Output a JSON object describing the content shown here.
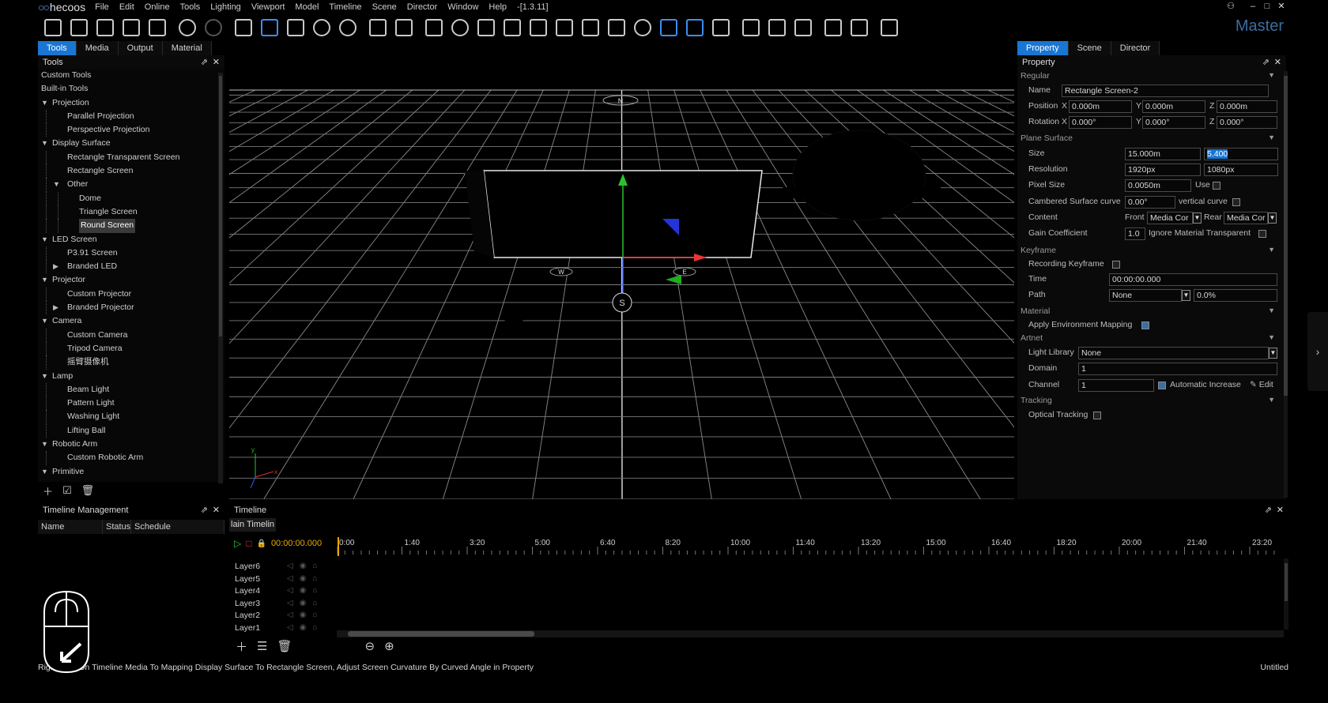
{
  "app": {
    "logo_text": "hecoos",
    "version": "-[1.3.11]",
    "master_label": "Master",
    "document": "Untitled"
  },
  "menu": [
    "File",
    "Edit",
    "Online",
    "Tools",
    "Lighting",
    "Viewport",
    "Model",
    "Timeline",
    "Scene",
    "Director",
    "Window",
    "Help"
  ],
  "left_tabs": [
    "Tools",
    "Media",
    "Output",
    "Material"
  ],
  "tools_panel": {
    "title": "Tools",
    "tree": [
      {
        "label": "Custom Tools",
        "depth": 0,
        "toggle": ""
      },
      {
        "label": "Built-in Tools",
        "depth": 0,
        "toggle": ""
      },
      {
        "label": "Projection",
        "depth": 0,
        "toggle": "▼"
      },
      {
        "label": "Parallel Projection",
        "depth": 1,
        "toggle": ""
      },
      {
        "label": "Perspective Projection",
        "depth": 1,
        "toggle": ""
      },
      {
        "label": "Display Surface",
        "depth": 0,
        "toggle": "▼"
      },
      {
        "label": "Rectangle Transparent Screen",
        "depth": 1,
        "toggle": ""
      },
      {
        "label": "Rectangle Screen",
        "depth": 1,
        "toggle": ""
      },
      {
        "label": "Other",
        "depth": 1,
        "toggle": "▼"
      },
      {
        "label": "Dome",
        "depth": 2,
        "toggle": ""
      },
      {
        "label": "Triangle Screen",
        "depth": 2,
        "toggle": ""
      },
      {
        "label": "Round Screen",
        "depth": 2,
        "toggle": "",
        "selected": true
      },
      {
        "label": "LED Screen",
        "depth": 0,
        "toggle": "▼"
      },
      {
        "label": "P3.91 Screen",
        "depth": 1,
        "toggle": ""
      },
      {
        "label": "Branded LED",
        "depth": 1,
        "toggle": "▶"
      },
      {
        "label": "Projector",
        "depth": 0,
        "toggle": "▼"
      },
      {
        "label": "Custom Projector",
        "depth": 1,
        "toggle": ""
      },
      {
        "label": "Branded Projector",
        "depth": 1,
        "toggle": "▶"
      },
      {
        "label": "Camera",
        "depth": 0,
        "toggle": "▼"
      },
      {
        "label": "Custom Camera",
        "depth": 1,
        "toggle": ""
      },
      {
        "label": "Tripod Camera",
        "depth": 1,
        "toggle": ""
      },
      {
        "label": "摇臂摄像机",
        "depth": 1,
        "toggle": ""
      },
      {
        "label": "Lamp",
        "depth": 0,
        "toggle": "▼"
      },
      {
        "label": "Beam Light",
        "depth": 1,
        "toggle": ""
      },
      {
        "label": "Pattern Light",
        "depth": 1,
        "toggle": ""
      },
      {
        "label": "Washing Light",
        "depth": 1,
        "toggle": ""
      },
      {
        "label": "Lifting Ball",
        "depth": 1,
        "toggle": ""
      },
      {
        "label": "Robotic Arm",
        "depth": 0,
        "toggle": "▼"
      },
      {
        "label": "Custom Robotic Arm",
        "depth": 1,
        "toggle": ""
      },
      {
        "label": "Primitive",
        "depth": 0,
        "toggle": "▼"
      }
    ]
  },
  "right_tabs": [
    "Property",
    "Scene",
    "Director"
  ],
  "property": {
    "title": "Property",
    "regular_label": "Regular",
    "name_label": "Name",
    "name_value": "Rectangle Screen-2",
    "position_label": "Position",
    "position": [
      "0.000m",
      "0.000m",
      "0.000m"
    ],
    "rotation_label": "Rotation",
    "rotation": [
      "0.000°",
      "0.000°",
      "0.000°"
    ],
    "axis_x": "X",
    "axis_y": "Y",
    "axis_z": "Z",
    "plane_label": "Plane Surface",
    "size_label": "Size",
    "size_w": "15.000m",
    "size_h": "5.400",
    "resolution_label": "Resolution",
    "res_w": "1920px",
    "res_h": "1080px",
    "pixel_label": "Pixel Size",
    "pixel_value": "0.0050m",
    "use_label": "Use",
    "curve_label": "Cambered Surface curve",
    "curve_value": "0.00°",
    "vcurve_label": "vertical curve",
    "content_label": "Content",
    "front_label": "Front",
    "front_value": "Media Cor",
    "rear_label": "Rear",
    "rear_value": "Media Cor",
    "gain_label": "Gain Coefficient",
    "gain_value": "1.0",
    "ignore_label": "Ignore Material Transparent",
    "keyframe_label": "Keyframe",
    "recording_label": "Recording Keyframe",
    "time_label": "Time",
    "time_value": "00:00:00.000",
    "path_label": "Path",
    "path_value": "None",
    "path_pct": "0.0%",
    "material_label": "Material",
    "apply_env_label": "Apply Environment Mapping",
    "artnet_label": "Artnet",
    "library_label": "Light Library",
    "library_value": "None",
    "domain_label": "Domain",
    "domain_value": "1",
    "channel_label": "Channel",
    "channel_value": "1",
    "auto_label": "Automatic Increase",
    "edit_label": "Edit",
    "tracking_label": "Tracking",
    "optical_label": "Optical Tracking"
  },
  "viewport": {
    "compass": [
      "N",
      "S",
      "W",
      "E"
    ],
    "axis": [
      "y",
      "x"
    ]
  },
  "timeline_mgmt": {
    "title": "Timeline Management",
    "cols": [
      "Name",
      "Status",
      "Schedule"
    ]
  },
  "timeline": {
    "title": "Timeline",
    "subtab": "lain Timelin",
    "time": "00:00:00.000",
    "ruler": [
      "0:00",
      "1:40",
      "3:20",
      "5:00",
      "6:40",
      "8:20",
      "10:00",
      "11:40",
      "13:20",
      "15:00",
      "16:40",
      "18:20",
      "20:00",
      "21:40",
      "23:20"
    ],
    "layers": [
      "Layer6",
      "Layer5",
      "Layer4",
      "Layer3",
      "Layer2",
      "Layer1"
    ]
  },
  "status": {
    "message": "Right-click On Timeline Media To Mapping Display Surface To Rectangle Screen, Adjust Screen Curvature By Curved Angle in Property"
  },
  "colors": {
    "accent": "#1976d2",
    "timecode": "#e7a800",
    "master": "#3d6c9e"
  }
}
